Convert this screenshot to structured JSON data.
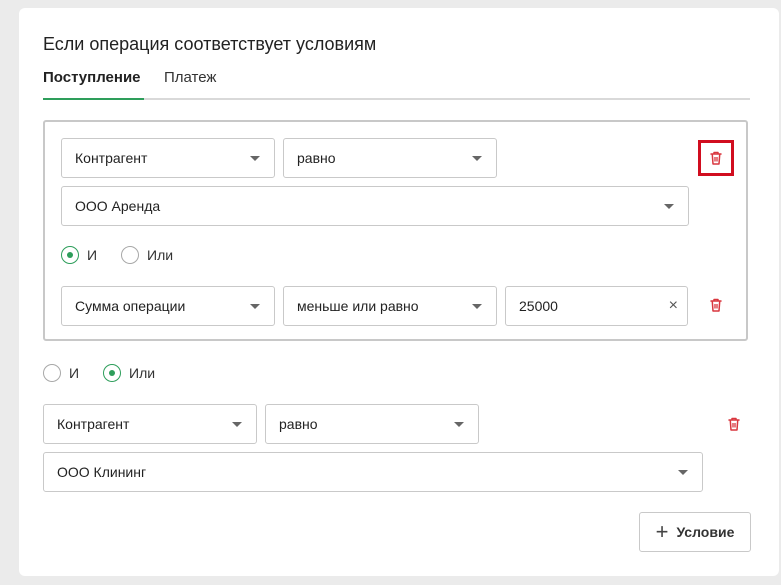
{
  "title": "Если операция соответствует условиям",
  "tabs": [
    {
      "label": "Поступление",
      "active": true
    },
    {
      "label": "Платеж",
      "active": false
    }
  ],
  "group": {
    "row1": {
      "field": "Контрагент",
      "operator": "равно",
      "value": "ООО Аренда"
    },
    "logic": {
      "and_label": "И",
      "or_label": "Или",
      "selected": "И"
    },
    "row2": {
      "field": "Сумма операции",
      "operator": "меньше или равно",
      "value": "25000",
      "clear_glyph": "×"
    }
  },
  "outer_logic": {
    "and_label": "И",
    "or_label": "Или",
    "selected": "Или"
  },
  "row3": {
    "field": "Контрагент",
    "operator": "равно",
    "value": "ООО Клининг"
  },
  "add_button": {
    "plus": "+",
    "label": "Условие"
  },
  "colors": {
    "accent": "#2e9e5b",
    "delete": "#d9363e",
    "highlight": "#d10d1f"
  },
  "icons": {
    "delete": "trash-icon",
    "dropdown": "chevron-down-icon",
    "add": "plus-icon"
  }
}
